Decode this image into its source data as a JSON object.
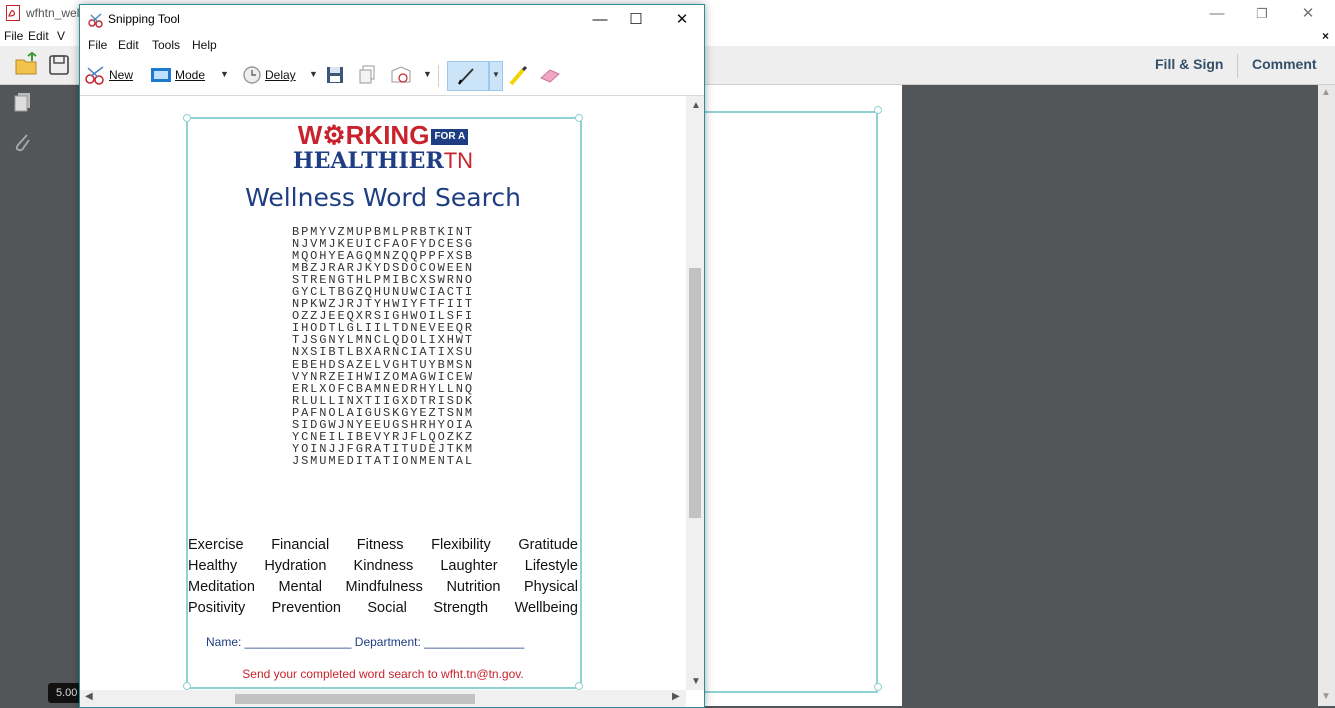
{
  "reader": {
    "window_title": "wfhtn_wel",
    "menu": [
      "File",
      "Edit",
      "V"
    ],
    "close_symbol": "×",
    "fill_sign": "Fill & Sign",
    "comment": "Comment",
    "zoom": "5.00"
  },
  "snip": {
    "title": "Snipping Tool",
    "controls": {
      "minimize": "—",
      "maximize": "☐",
      "close": "✕"
    },
    "menu": [
      "File",
      "Edit",
      "Tools",
      "Help"
    ],
    "toolbar": {
      "new_label": "New",
      "mode_label": "Mode",
      "delay_label": "Delay"
    }
  },
  "worksheet": {
    "logo_line1": "W",
    "logo_line1_rest": "RKING",
    "logo_flag": "FOR A",
    "logo_line2": "HEALTHIER",
    "logo_line2_tn": "TN",
    "title": "Wellness Word Search",
    "grid": [
      "BPMYVZMUPBMLPRBTKINT",
      "NJVMJKEUICFAOFYDCESG",
      "MQOHYEAGQMNZQQPPFXSB",
      "MBZJRARJKYDSDOCOWEEN",
      "STRENGTHLPMIBCXSWRNO",
      "GYCLTBGZQHUNUWCIACTI",
      "NPKWZJRJTYHWIYFTFIIT",
      "OZZJEEQXRSIGHWOILSFI",
      "IHODTLGLIILTDNEVEEQR",
      "TJSGNYLMNCLQDOLIXHWT",
      "NXSIBTLBXARNCIATIXSU",
      "EBEHDSAZELVGHTUYBMSN",
      "VYNRZEIHWIZOMAGWICEW",
      "ERLXOFCBAMNEDRHYLLNQ",
      "RLULLINXTIIGXDTRISDK",
      "PAFNOLAIGUSKGYEZTSNM",
      "SIDGWJNYEEUGSHRHYOIA",
      "YCNEILIBEVYRJFLQOZKZ",
      "YOINJJFGRATITUDEJTKM",
      "JSMUMEDITATIONMENTAL"
    ],
    "word_rows": [
      [
        "Exercise",
        "Financial",
        "Fitness",
        "Flexibility",
        "Gratitude"
      ],
      [
        "Healthy",
        "Hydration",
        "Kindness",
        "Laughter",
        "Lifestyle"
      ],
      [
        "Meditation",
        "Mental",
        "Mindfulness",
        "Nutrition",
        "Physical"
      ],
      [
        "Positivity",
        "Prevention",
        "Social",
        "Strength",
        "Wellbeing"
      ]
    ],
    "footer_fields": "Name: ________________  Department: _______________",
    "footer_send": "Send your completed word search to wfht.tn@tn.gov."
  },
  "colors": {
    "accent_red": "#c8232c",
    "accent_blue": "#1f3d82",
    "frame_teal": "#8fd2d3",
    "snip_border": "#2b8d9a"
  },
  "icons": [
    "pdf-icon",
    "open-folder-icon",
    "save-icon",
    "pages-icon",
    "paperclip-icon",
    "scissors-icon",
    "clock-icon",
    "copy-icon",
    "send-icon",
    "pen-icon",
    "highlighter-icon",
    "eraser-icon"
  ]
}
